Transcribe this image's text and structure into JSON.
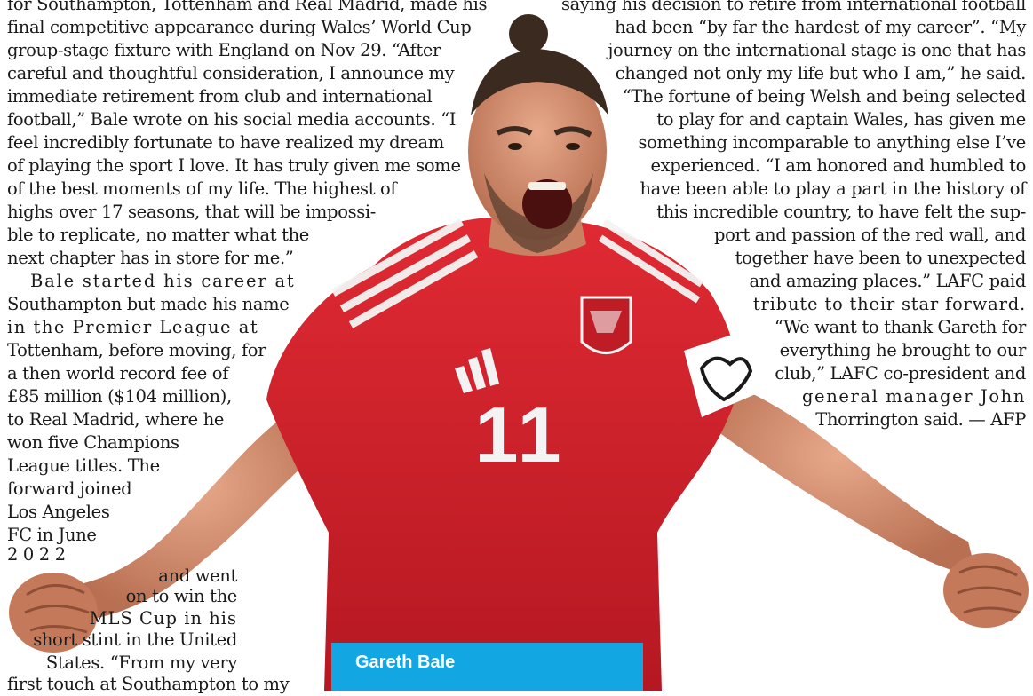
{
  "article": {
    "left_column": [
      "for Southampton, Tottenham and Real Madrid, made his",
      "final competitive appearance during Wales’ World Cup",
      "group-stage fixture with England on Nov 29. “After",
      "careful and thoughtful consideration, I announce my",
      "immediate retirement from club and international",
      "football,” Bale wrote on his social media accounts. “I",
      "feel incredibly fortunate to have realized my dream",
      "of playing the sport I love. It has truly given me some",
      "of the best moments of my life. The highest of",
      "highs over 17 seasons, that will be impossi-",
      "ble to replicate, no matter what the",
      "next chapter has in store for me.”",
      "Bale started his career at",
      "Southampton but made his name",
      "in the Premier League at",
      "Tottenham, before moving, for",
      "a then world record fee of",
      "£85 million ($104 million),",
      "to Real Madrid, where he",
      "won five Champions",
      "League titles. The",
      "forward joined",
      "Los Angeles",
      "FC in June",
      "2 0 2 2",
      "and went",
      "on to win the",
      "MLS Cup in his",
      "short stint in the United",
      "States. “From my very",
      "first touch at Southampton to my"
    ],
    "right_column": [
      "saying his decision to retire from international football",
      "had been “by far the hardest of my career”. “My",
      "journey on the international stage is one that has",
      "changed not only my life but who I am,” he said.",
      "“The fortune of being Welsh and being selected",
      "to play for and captain Wales, has given me",
      "something incomparable to anything else I’ve",
      "experienced. “I am honored and humbled to",
      "have been able to play a part in the history of",
      "this incredible country, to have felt the sup-",
      "port and passion of the red wall, and",
      "together have been to unexpected",
      "and amazing places.” LAFC paid",
      "tribute to their star forward.",
      "“We want to thank Gareth for",
      "everything he brought to our",
      "club,” LAFC co-president and",
      "general manager John",
      "Thorrington said. — AFP"
    ]
  },
  "photo": {
    "caption": "Gareth Bale",
    "shirt_number": "11",
    "shirt_color": "#d4212c",
    "caption_color": "#12a7e3"
  }
}
